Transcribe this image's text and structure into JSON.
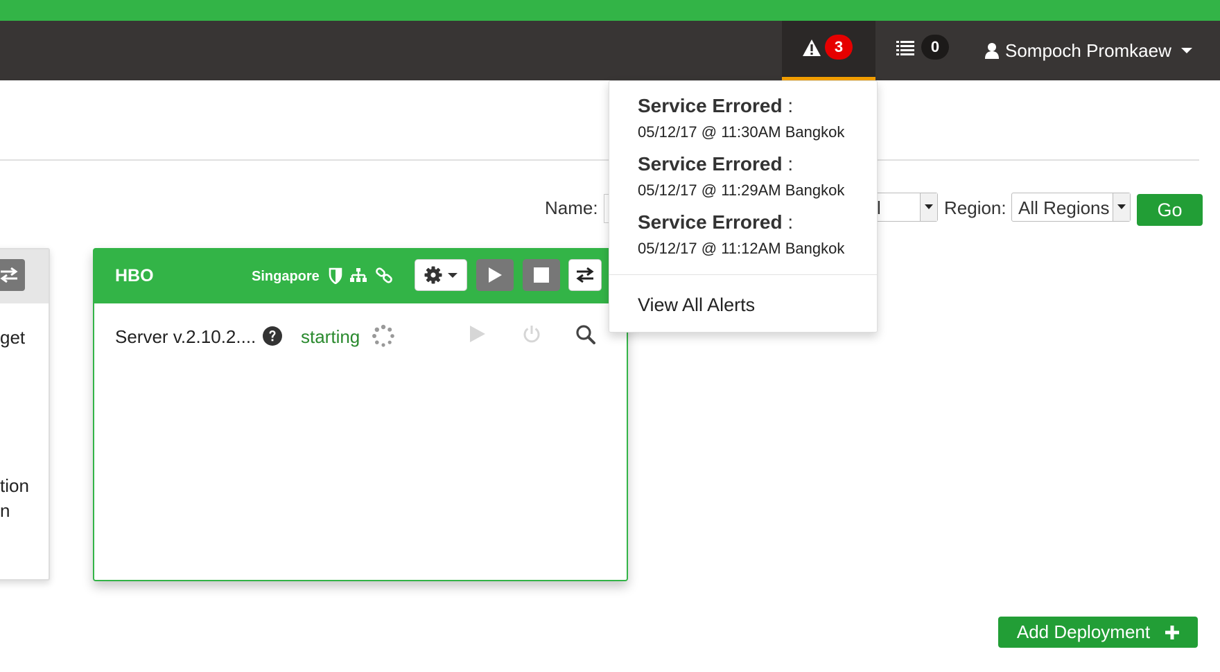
{
  "navbar": {
    "alerts_count": "3",
    "tasks_count": "0",
    "user_name": "Sompoch Promkaew",
    "colors": {
      "top_strip": "#33b447",
      "navbar": "#383534",
      "active_underline": "#f5a000",
      "alert_badge": "#e60000"
    }
  },
  "filters": {
    "name_label": "Name:",
    "partial_select_value": "l",
    "region_label": "Region:",
    "region_value": "All Regions",
    "go_label": "Go"
  },
  "left_card": {
    "text_1": "get",
    "text_2": "tion",
    "text_3": "n"
  },
  "deployment_card": {
    "title": "HBO",
    "region": "Singapore",
    "header_icons": [
      "shield-icon",
      "sitemap-icon",
      "link-icon"
    ],
    "buttons": [
      "gear-dropdown",
      "play",
      "stop",
      "swap"
    ],
    "service": {
      "name": "Server v.2.10.2....",
      "status": "starting"
    },
    "accent_color": "#33b447"
  },
  "alerts_dropdown": {
    "items": [
      {
        "title": "Service Errored",
        "separator": ":",
        "time": "05/12/17 @ 11:30AM Bangkok"
      },
      {
        "title": "Service Errored",
        "separator": ":",
        "time": "05/12/17 @ 11:29AM Bangkok"
      },
      {
        "title": "Service Errored",
        "separator": ":",
        "time": "05/12/17 @ 11:12AM Bangkok"
      }
    ],
    "view_all_label": "View All Alerts"
  },
  "add_deployment_label": "Add Deployment"
}
